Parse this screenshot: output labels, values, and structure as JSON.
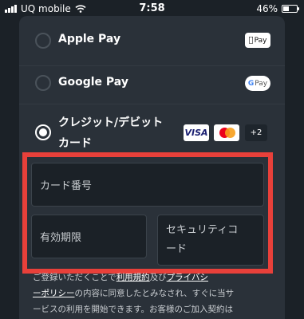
{
  "status_bar": {
    "carrier": "UQ mobile",
    "time": "7:58",
    "battery": "46%",
    "battery_level": 0.46
  },
  "payment_methods": [
    {
      "label": "Apple Pay",
      "selected": false,
      "badge": "Pay",
      "icon": "apple-pay-logo"
    },
    {
      "label": "Google Pay",
      "selected": false,
      "badge": "Pay",
      "icon": "google-pay-logo"
    },
    {
      "label": "クレジット/デビット",
      "label_line2": "カード",
      "selected": true,
      "brands": [
        "VISA",
        "mastercard"
      ],
      "more": "+2"
    }
  ],
  "card_form": {
    "card_number_placeholder": "カード番号",
    "expiry_placeholder": "有効期限",
    "cvc_placeholder_line1": "セキュリティコ",
    "cvc_placeholder_line2": "ード"
  },
  "footer": {
    "line1_pre": "ご登録いただくことで",
    "line1_link1": "利用規約",
    "line1_mid": "及び",
    "line1_link2": "プライバシ",
    "line2_link": "ーポリシー",
    "line2_post": "の内容に同意したとみなされ、すぐに当サ",
    "line3": "ービスの利用を開始できます。お客様のご加入契約は"
  },
  "colors": {
    "background": "#1b2127",
    "card": "#2a3139",
    "highlight": "#e8403a"
  }
}
